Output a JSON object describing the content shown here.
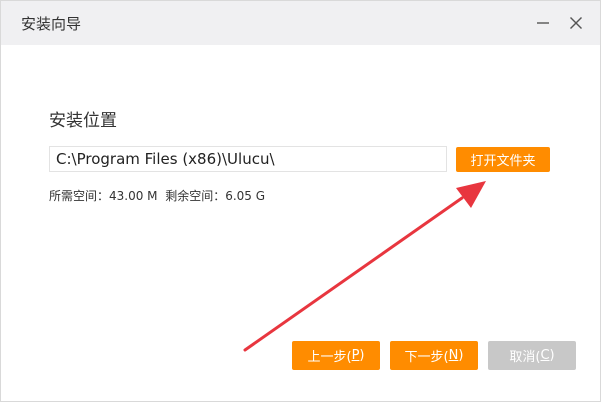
{
  "window": {
    "title": "安装向导",
    "minimize_icon": "minimize-icon",
    "close_icon": "close-icon"
  },
  "install": {
    "section_title": "安装位置",
    "path_value": "C:\\Program Files (x86)\\Ulucu\\",
    "browse_label": "打开文件夹",
    "required_label": "所需空间：",
    "required_value": "43.00 M",
    "free_label": "剩余空间：",
    "free_value": "6.05 G"
  },
  "buttons": {
    "prev_text": "上一步(",
    "prev_mnemonic": "P",
    "prev_close": ")",
    "next_text": "下一步(",
    "next_mnemonic": "N",
    "next_close": ")",
    "cancel_text": "取消(",
    "cancel_mnemonic": "C",
    "cancel_close": ")"
  },
  "annotation": {
    "arrow_color": "#e8363f"
  },
  "colors": {
    "accent": "#ff8c00",
    "disabled": "#c8c8c8",
    "titlebar": "#f0f0f2"
  }
}
